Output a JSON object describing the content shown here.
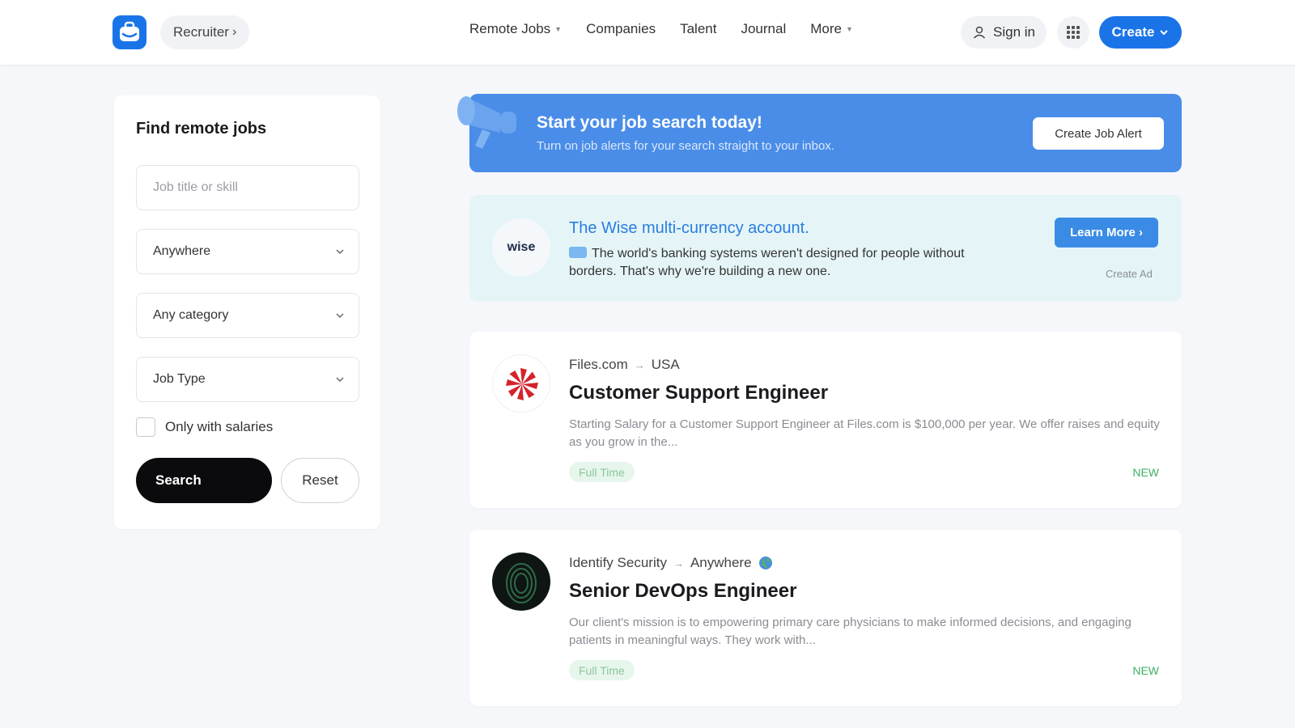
{
  "header": {
    "recruiter_label": "Recruiter",
    "nav": [
      {
        "label": "Remote Jobs",
        "has_caret": true
      },
      {
        "label": "Companies",
        "has_caret": false
      },
      {
        "label": "Talent",
        "has_caret": false
      },
      {
        "label": "Journal",
        "has_caret": false
      },
      {
        "label": "More",
        "has_caret": true
      }
    ],
    "signin_label": "Sign in",
    "create_label": "Create"
  },
  "sidebar": {
    "title": "Find remote jobs",
    "search_placeholder": "Job title or skill",
    "location_value": "Anywhere",
    "category_value": "Any category",
    "jobtype_value": "Job Type",
    "salary_checkbox_label": "Only with salaries",
    "search_button": "Search",
    "reset_button": "Reset"
  },
  "banner": {
    "title": "Start your job search today!",
    "subtitle": "Turn on job alerts for your search straight to your inbox.",
    "button": "Create Job Alert"
  },
  "ad": {
    "logo_text": "wise",
    "title": "The Wise multi-currency account.",
    "text": "The world's banking systems weren't designed for people without borders. That's why we're building a new one.",
    "button": "Learn More ›",
    "small_link": "Create Ad"
  },
  "jobs": [
    {
      "company": "Files.com",
      "location": "USA",
      "title": "Customer Support Engineer",
      "description": "Starting Salary for a Customer Support Engineer at Files.com is $100,000 per year. We offer raises and equity as you grow in the...",
      "tag": "Full Time",
      "badge": "NEW"
    },
    {
      "company": "Identify Security",
      "location": "Anywhere",
      "title": "Senior DevOps Engineer",
      "description": "Our client's mission is to empowering primary care physicians to make informed decisions, and engaging patients in meaningful ways. They work with...",
      "tag": "Full Time",
      "badge": "NEW"
    }
  ],
  "colors": {
    "accent": "#1a74e8",
    "banner": "#4a8de8",
    "ad_bg": "#e5f5f7",
    "new_green": "#3fae66"
  }
}
